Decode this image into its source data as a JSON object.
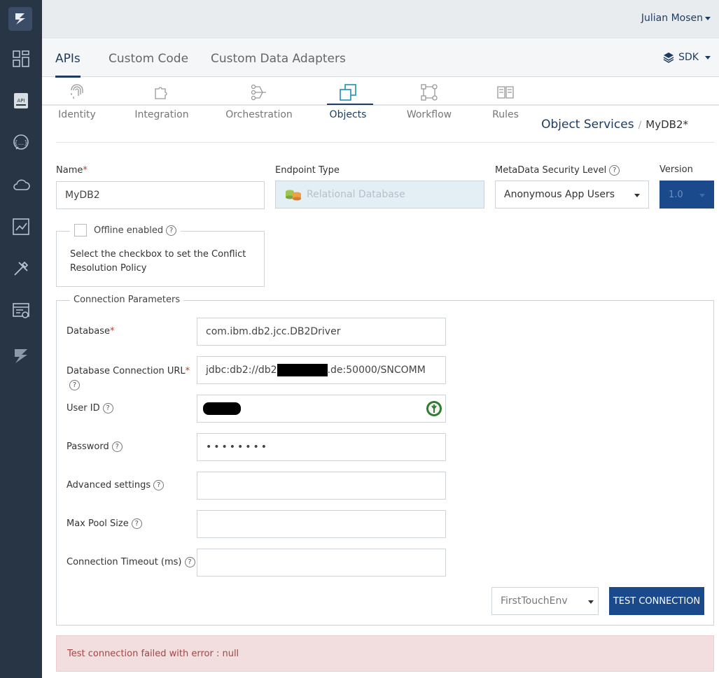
{
  "topbar": {
    "user_name": "Julian Mosen"
  },
  "main_tabs": [
    {
      "label": "APIs",
      "active": true
    },
    {
      "label": "Custom Code",
      "active": false
    },
    {
      "label": "Custom Data Adapters",
      "active": false
    }
  ],
  "sdk_menu": {
    "label": "SDK"
  },
  "sub_tabs": [
    {
      "label": "Identity",
      "icon": "fingerprint-icon"
    },
    {
      "label": "Integration",
      "icon": "puzzle-icon"
    },
    {
      "label": "Orchestration",
      "icon": "orchestration-icon"
    },
    {
      "label": "Objects",
      "icon": "objects-icon",
      "active": true
    },
    {
      "label": "Workflow",
      "icon": "workflow-icon"
    },
    {
      "label": "Rules",
      "icon": "rules-icon"
    }
  ],
  "breadcrumb": {
    "parent": "Object Services",
    "separator": "/",
    "current": "MyDB2",
    "modified_marker": "*"
  },
  "form": {
    "name_label": "Name",
    "required_marker": "*",
    "name_value": "MyDB2",
    "endpoint_type_label": "Endpoint Type",
    "endpoint_type_value": "Relational Database",
    "metadata_security_label": "MetaData Security Level",
    "metadata_security_value": "Anonymous App Users",
    "version_label": "Version",
    "version_value": "1.0",
    "help_glyph": "?"
  },
  "offline": {
    "label": "Offline enabled",
    "description": "Select the checkbox to set the Conflict Resolution Policy"
  },
  "connection": {
    "legend": "Connection Parameters",
    "database_label": "Database",
    "database_value": "com.ibm.db2.jcc.DB2Driver",
    "url_label": "Database Connection URL",
    "url_prefix": "jdbc:db2://db2",
    "url_suffix": ".de:50000/SNCOMM",
    "user_id_label": "User ID",
    "password_label": "Password",
    "password_value": "••••••••",
    "advanced_label": "Advanced settings",
    "pool_size_label": "Max Pool Size",
    "timeout_label": "Connection Timeout (ms)"
  },
  "environment": {
    "selected": "FirstTouchEnv"
  },
  "test_button": {
    "label": "TEST CONNECTION"
  },
  "alert": {
    "message": "Test connection failed with error : null"
  },
  "colors": {
    "sidebar": "#273545",
    "accent": "#1b4a8c",
    "error_bg": "#f2dede",
    "error_text": "#a94442"
  }
}
